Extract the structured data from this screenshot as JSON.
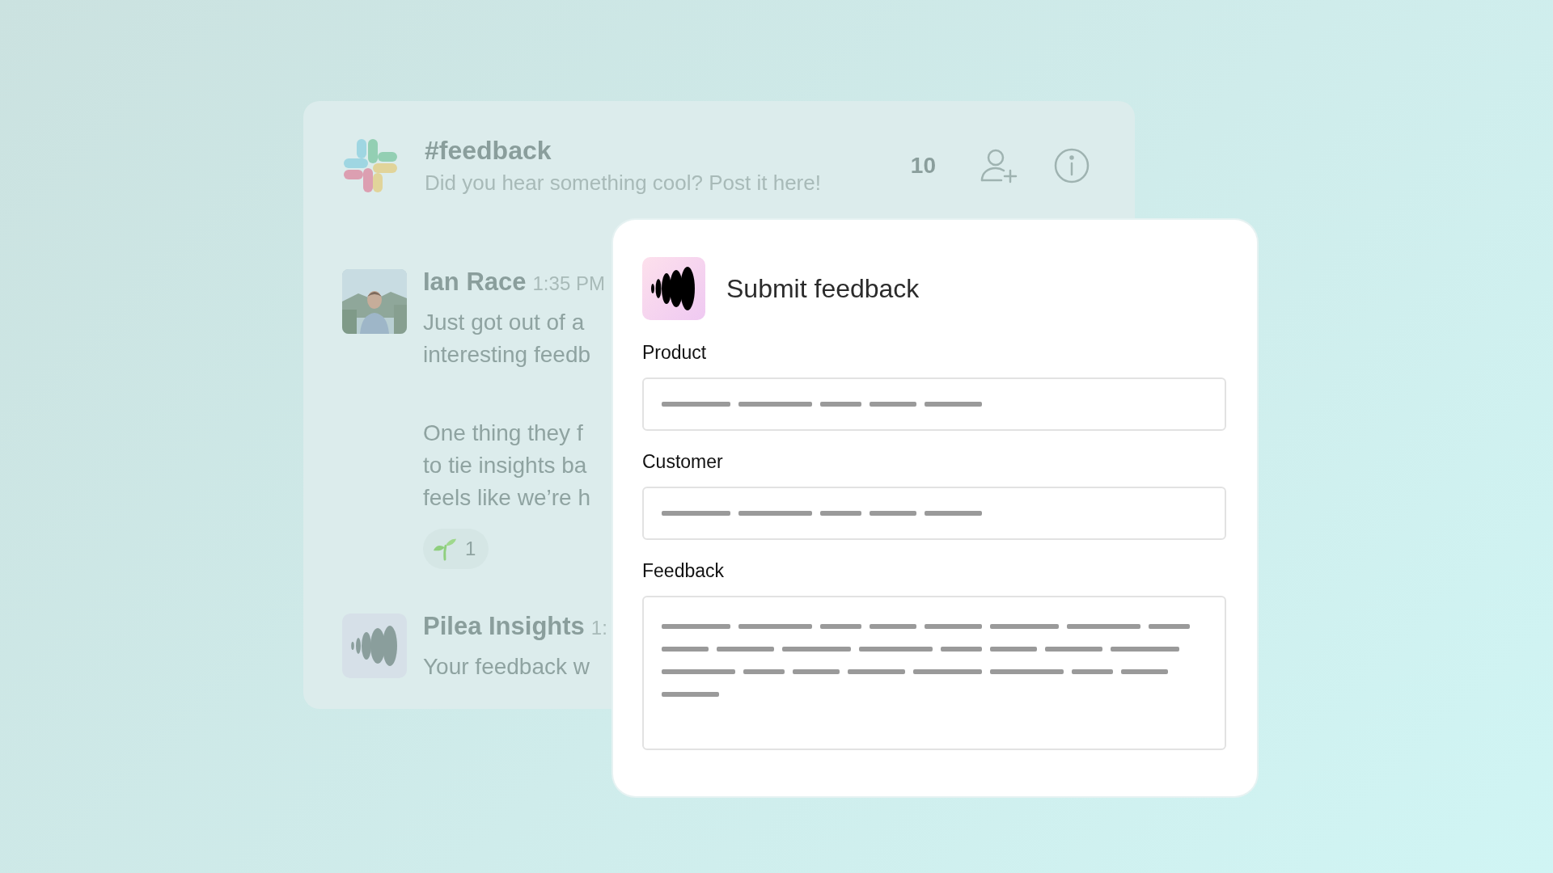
{
  "channel": {
    "name": "#feedback",
    "topic": "Did you hear something cool? Post it here!",
    "member_count": "10"
  },
  "messages": [
    {
      "author": "Ian Race",
      "time": "1:35 PM",
      "avatar": {
        "kind": "picture"
      },
      "paragraphs": [
        [
          "Just got out of a",
          "interesting feedb"
        ],
        [
          "One thing they f",
          "to tie insights ba",
          "feels like we’re h"
        ]
      ],
      "reactions": [
        {
          "count": "1"
        }
      ]
    },
    {
      "author": "Pilea Insights",
      "time": "1:",
      "avatar": {
        "kind": "icon"
      },
      "paragraphs": [
        [
          "Your feedback w"
        ]
      ]
    }
  ],
  "dialog": {
    "title": "Submit feedback",
    "fields": [
      {
        "label": "Product",
        "kind": "input"
      },
      {
        "label": "Customer",
        "kind": "input"
      },
      {
        "label": "Feedback",
        "kind": "textarea"
      }
    ]
  }
}
